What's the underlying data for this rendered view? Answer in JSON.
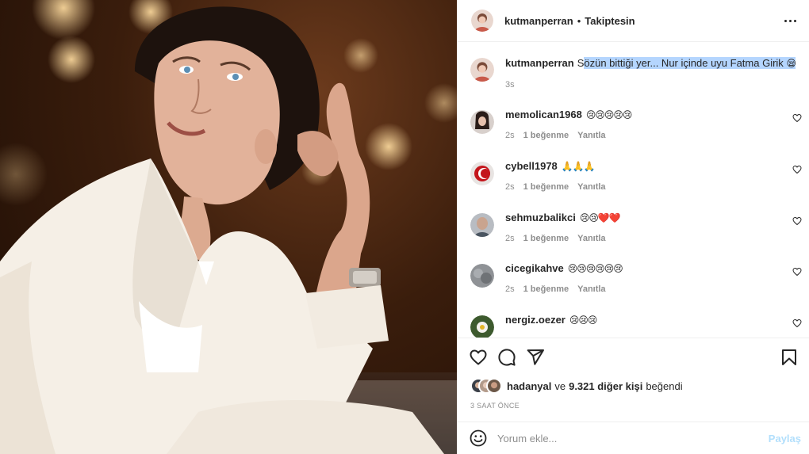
{
  "post": {
    "author": "kutmanperran",
    "separator": "•",
    "follow_status": "Takiptesin",
    "caption_plain": "S",
    "caption_highlight": "özün bittiği yer... Nur içinde uyu Fatma Girik",
    "caption_emoji": "😪",
    "caption_time": "3s"
  },
  "comments": [
    {
      "user": "memolican1968",
      "text": "😢😢😢😢😢",
      "time": "2s",
      "likes": "1 beğenme",
      "reply": "Yanıtla"
    },
    {
      "user": "cybell1978",
      "text": "🙏🙏🙏",
      "time": "2s",
      "likes": "1 beğenme",
      "reply": "Yanıtla"
    },
    {
      "user": "sehmuzbalikci",
      "text": "😢😢❤️❤️",
      "time": "2s",
      "likes": "1 beğenme",
      "reply": "Yanıtla"
    },
    {
      "user": "cicegikahve",
      "text": "😢😢😢😢😢😢",
      "time": "2s",
      "likes": "1 beğenme",
      "reply": "Yanıtla"
    },
    {
      "user": "nergiz.oezer",
      "text": "😢😢😢",
      "time": "",
      "likes": "",
      "reply": ""
    }
  ],
  "likes": {
    "first_user": "hadanyal",
    "joiner": "ve",
    "others": "9.321 diğer kişi",
    "suffix": "beğendi"
  },
  "timestamp": "3 SAAT ÖNCE",
  "comment_box": {
    "placeholder": "Yorum ekle...",
    "post_label": "Paylaş"
  },
  "colors": {
    "text": "#262626",
    "secondary": "#8e8e8e",
    "border": "#efefef",
    "highlight": "#b4d5fe",
    "post_disabled": "#b2dffc"
  },
  "icons": [
    "more-options-icon",
    "heart-icon",
    "comment-icon",
    "share-icon",
    "bookmark-icon",
    "emoji-icon",
    "small-heart-icon"
  ]
}
